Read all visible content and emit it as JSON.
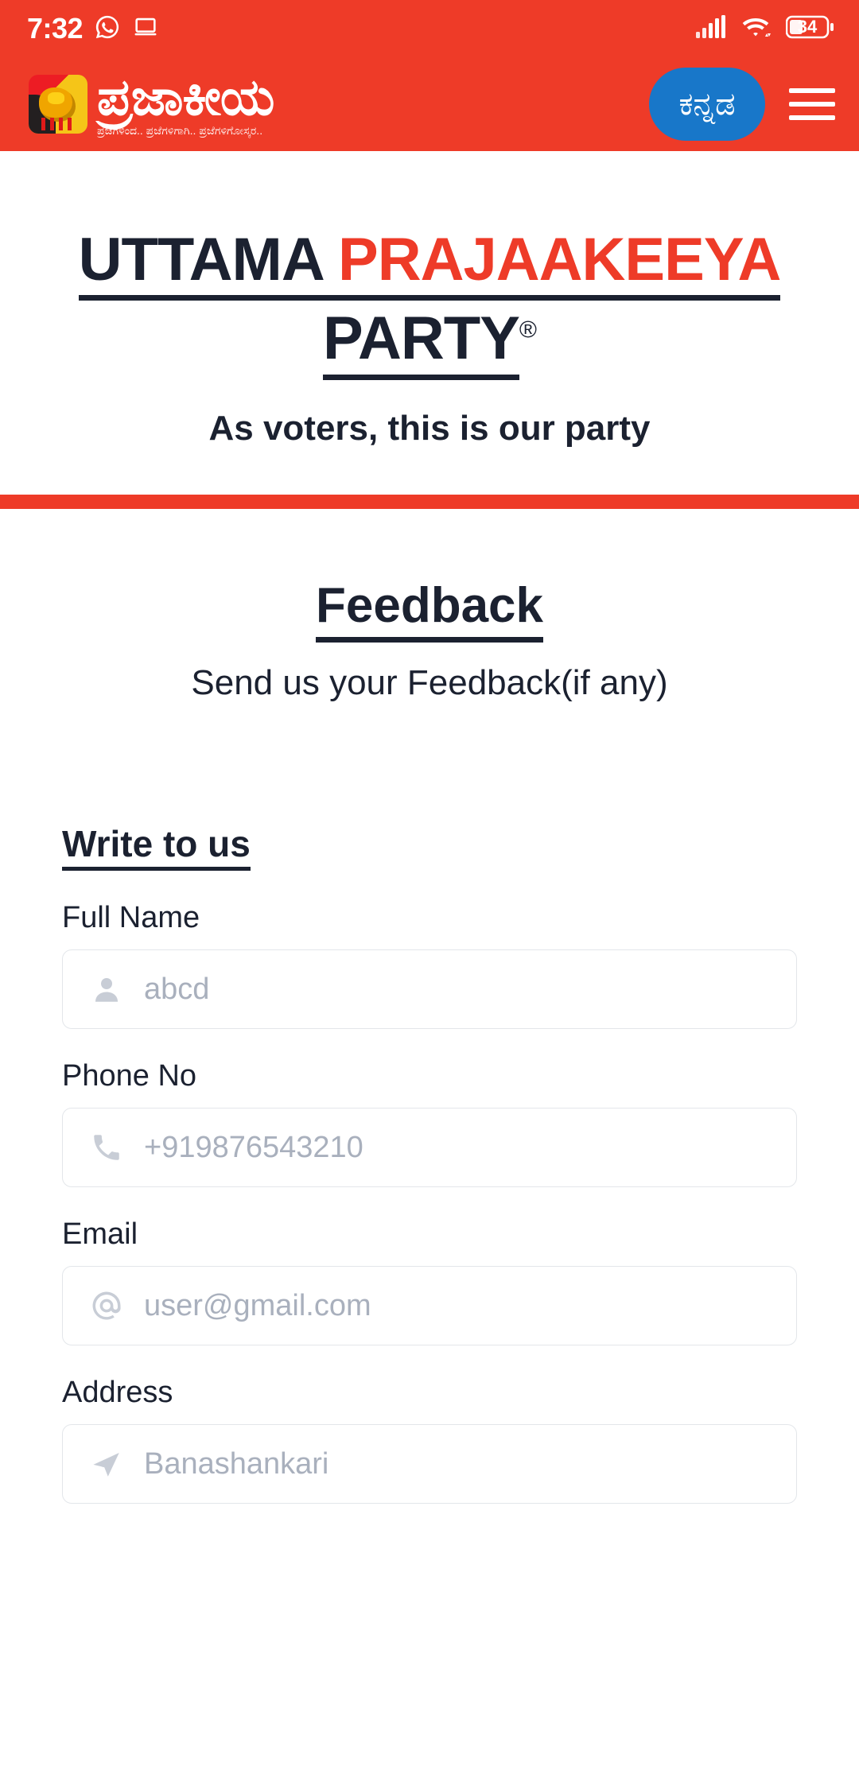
{
  "status_bar": {
    "time": "7:32",
    "battery_level": "34",
    "icons": [
      "whatsapp-icon",
      "desktop-icon",
      "signal-icon",
      "wifi-icon",
      "battery-icon"
    ]
  },
  "header": {
    "brand_title": "ಪ್ರಜಾಕೀಯ",
    "brand_tagline": "ಪ್ರಜೆಗಳಿಂದ.. ಪ್ರಜೆಗಳಿಗಾಗಿ.. ಪ್ರಜೆಗಳಿಗೋಸ್ಕರ..",
    "language_button": "ಕನ್ನಡ",
    "menu_icon": "hamburger-icon",
    "bg_color": "#ee3b28",
    "language_button_color": "#1877c9"
  },
  "hero": {
    "title_part1": "UTTAMA ",
    "title_part2": "PRAJAAKEEYA",
    "title_line2": "PARTY",
    "registered_mark": "®",
    "subtitle": "As voters, this is our party",
    "accent_color": "#ee3b28",
    "text_color": "#1b2130"
  },
  "feedback": {
    "title": "Feedback",
    "subtitle": "Send us your Feedback(if any)"
  },
  "form": {
    "heading": "Write to us",
    "fields": [
      {
        "label": "Full Name",
        "placeholder": "abcd",
        "icon": "person-icon"
      },
      {
        "label": "Phone No",
        "placeholder": "+919876543210",
        "icon": "phone-icon"
      },
      {
        "label": "Email",
        "placeholder": "user@gmail.com",
        "icon": "at-icon"
      },
      {
        "label": "Address",
        "placeholder": "Banashankari",
        "icon": "send-icon"
      }
    ]
  }
}
